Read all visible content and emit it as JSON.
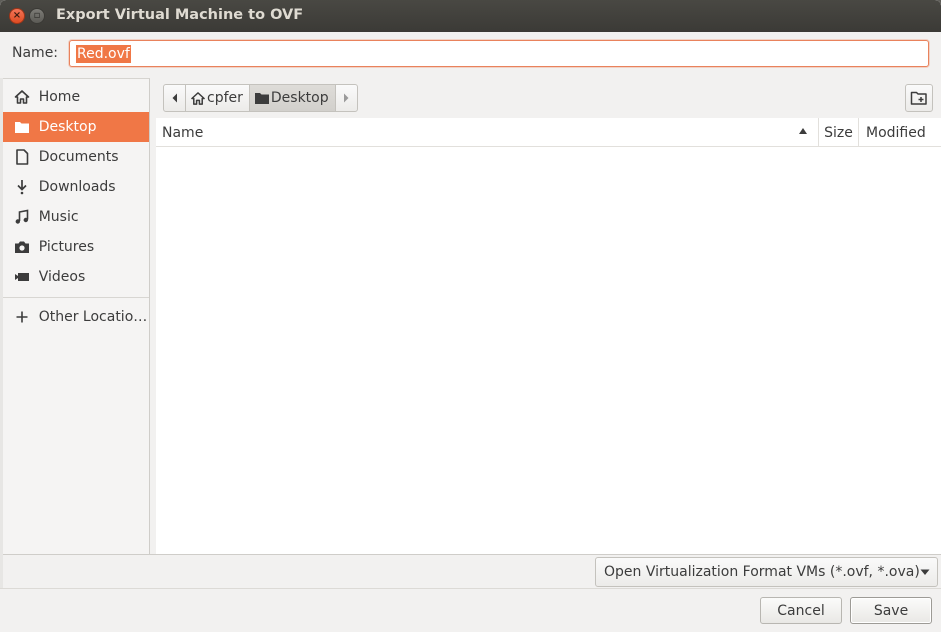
{
  "window": {
    "title": "Export Virtual Machine to OVF",
    "close_glyph": "×",
    "max_glyph": "▫"
  },
  "name_field": {
    "label": "Name:",
    "value": "Red.ovf"
  },
  "sidebar": {
    "items": [
      {
        "label": "Home",
        "icon": "home-icon",
        "active": false
      },
      {
        "label": "Desktop",
        "icon": "folder-icon",
        "active": true
      },
      {
        "label": "Documents",
        "icon": "document-icon",
        "active": false
      },
      {
        "label": "Downloads",
        "icon": "download-icon",
        "active": false
      },
      {
        "label": "Music",
        "icon": "music-icon",
        "active": false
      },
      {
        "label": "Pictures",
        "icon": "camera-icon",
        "active": false
      },
      {
        "label": "Videos",
        "icon": "video-icon",
        "active": false
      }
    ],
    "other": {
      "label": "Other Locations",
      "icon": "plus-icon"
    }
  },
  "pathbar": {
    "segments": [
      {
        "label": "cpfer",
        "icon": "home-icon"
      },
      {
        "label": "Desktop",
        "icon": "folder-icon"
      }
    ]
  },
  "file_list": {
    "columns": {
      "name": "Name",
      "size": "Size",
      "modified": "Modified"
    },
    "rows": []
  },
  "filter": {
    "selected": "Open Virtualization Format VMs (*.ovf, *.ova)"
  },
  "buttons": {
    "cancel": "Cancel",
    "save": "Save"
  },
  "colors": {
    "accent": "#f07746",
    "titlebar": "#3c3b37"
  }
}
